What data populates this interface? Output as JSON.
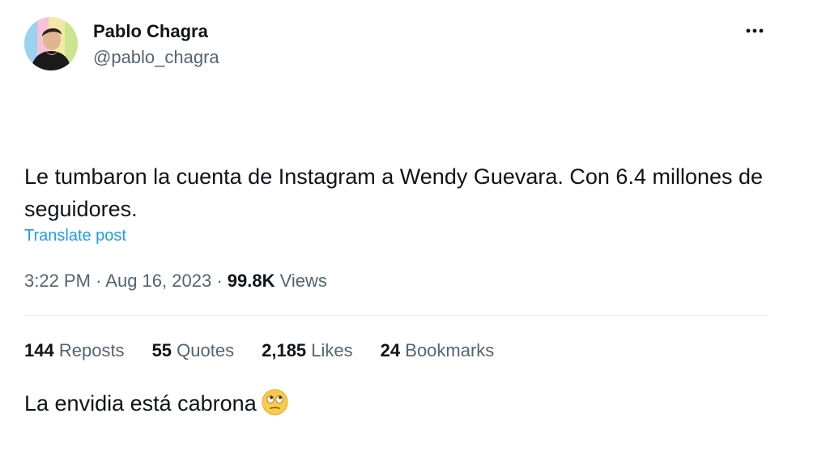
{
  "author": {
    "display_name": "Pablo Chagra",
    "handle": "@pablo_chagra",
    "avatar_icon": "avatar"
  },
  "more_icon": "more-horizontal-icon",
  "tweet": {
    "line1": "Le tumbaron la cuenta de Instagram a Wendy Guevara. Con 6.4 millones de seguidores.",
    "line2": "La envidia está cabrona",
    "emoji_icon": "face-with-rolling-eyes-icon"
  },
  "translate_label": "Translate post",
  "meta": {
    "time": "3:22 PM",
    "separator": "·",
    "date": "Aug 16, 2023",
    "views_count": "99.8K",
    "views_label": "Views"
  },
  "stats": {
    "reposts_count": "144",
    "reposts_label": "Reposts",
    "quotes_count": "55",
    "quotes_label": "Quotes",
    "likes_count": "2,185",
    "likes_label": "Likes",
    "bookmarks_count": "24",
    "bookmarks_label": "Bookmarks"
  },
  "colors": {
    "text_primary": "#0f1419",
    "text_secondary": "#536471",
    "link": "#1d9bf0",
    "divider": "#eff3f4"
  }
}
